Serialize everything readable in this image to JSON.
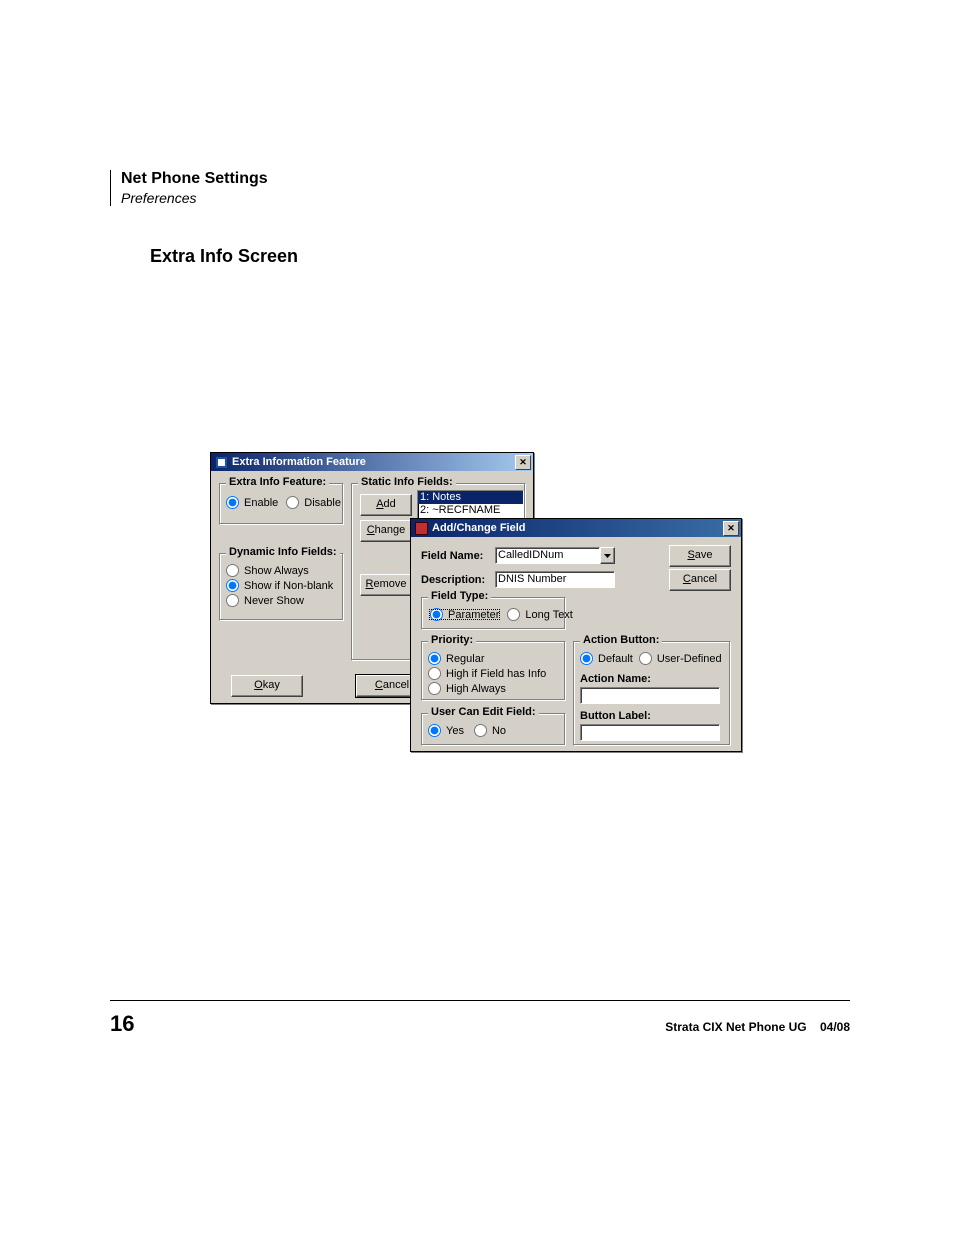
{
  "header": {
    "title": "Net Phone Settings",
    "subtitle": "Preferences"
  },
  "section_title": "Extra Info Screen",
  "win1": {
    "title": "Extra Information Feature",
    "extra_info_feature": {
      "legend": "Extra Info Feature:",
      "enable": "Enable",
      "disable": "Disable"
    },
    "dynamic_info": {
      "legend": "Dynamic Info Fields:",
      "opt1": "Show Always",
      "opt2": "Show if Non-blank",
      "opt3": "Never Show"
    },
    "static_info": {
      "legend": "Static Info Fields:",
      "add": "Add",
      "change": "Change",
      "remove": "Remove",
      "list": {
        "item1": "1: Notes",
        "item2": "2: ~RECFNAME"
      }
    },
    "okay": "Okay",
    "cancel": "Cancel"
  },
  "win2": {
    "title": "Add/Change Field",
    "field_name_label": "Field Name:",
    "field_name_value": "CalledIDNum",
    "description_label": "Description:",
    "description_value": "DNIS Number",
    "field_type": {
      "legend": "Field Type:",
      "parameter": "Parameter",
      "long_text": "Long Text"
    },
    "priority": {
      "legend": "Priority:",
      "regular": "Regular",
      "high_if": "High if Field has Info",
      "high_always": "High Always"
    },
    "user_edit": {
      "legend": "User Can Edit Field:",
      "yes": "Yes",
      "no": "No"
    },
    "action_button": {
      "legend": "Action Button:",
      "default": "Default",
      "user_defined": "User-Defined",
      "action_name_label": "Action Name:",
      "button_label_label": "Button Label:"
    },
    "save": "Save",
    "cancel": "Cancel"
  },
  "footer": {
    "page": "16",
    "doc": "Strata CIX Net Phone UG",
    "date": "04/08"
  }
}
